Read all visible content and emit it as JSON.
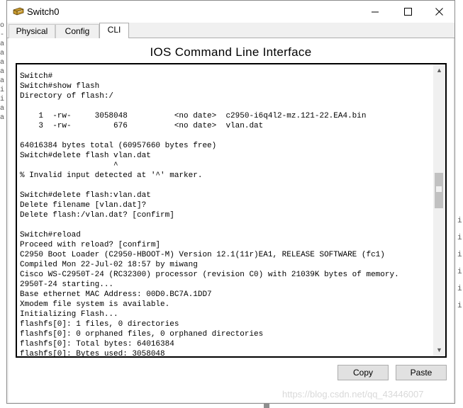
{
  "window": {
    "title": "Switch0"
  },
  "tabs": [
    {
      "label": "Physical"
    },
    {
      "label": "Config"
    },
    {
      "label": "CLI"
    }
  ],
  "cli": {
    "heading": "IOS Command Line Interface",
    "terminal_text": "Switch#\nSwitch#show flash\nDirectory of flash:/\n\n    1  -rw-     3058048          <no date>  c2950-i6q4l2-mz.121-22.EA4.bin\n    3  -rw-         676          <no date>  vlan.dat\n\n64016384 bytes total (60957660 bytes free)\nSwitch#delete flash vlan.dat\n                    ^\n% Invalid input detected at '^' marker.\n\nSwitch#delete flash:vlan.dat\nDelete filename [vlan.dat]?\nDelete flash:/vlan.dat? [confirm]\n\nSwitch#reload\nProceed with reload? [confirm]\nC2950 Boot Loader (C2950-HBOOT-M) Version 12.1(11r)EA1, RELEASE SOFTWARE (fc1)\nCompiled Mon 22-Jul-02 18:57 by miwang\nCisco WS-C2950T-24 (RC32300) processor (revision C0) with 21039K bytes of memory.\n2950T-24 starting...\nBase ethernet MAC Address: 00D0.BC7A.1DD7\nXmodem file system is available.\nInitializing Flash...\nflashfs[0]: 1 files, 0 directories\nflashfs[0]: 0 orphaned files, 0 orphaned directories\nflashfs[0]: Total bytes: 64016384\nflashfs[0]: Bytes used: 3058048",
    "copy_label": "Copy",
    "paste_label": "Paste"
  },
  "watermark": "https://blog.csdn.net/qq_43446007",
  "icons": {
    "app": "switch-device-icon",
    "minimize": "minimize-icon",
    "maximize": "maximize-icon",
    "close": "close-icon"
  }
}
